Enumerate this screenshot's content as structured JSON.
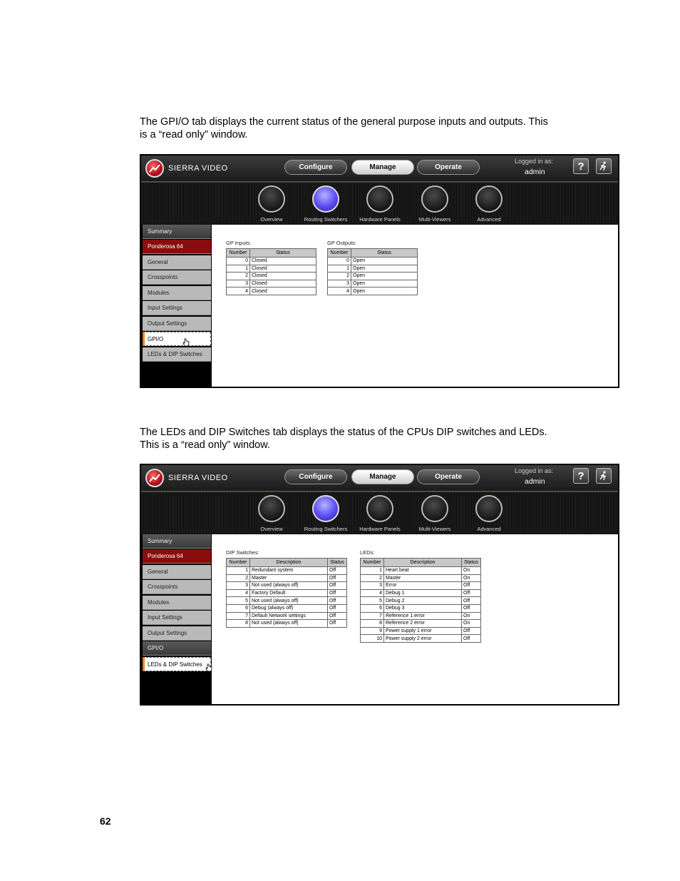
{
  "paragraphs": {
    "gpio_intro": [
      "The GPI/O tab displays the current status of the general purpose inputs and outputs. This",
      "is a “read only” window."
    ],
    "leds_intro": [
      "The LEDs and DIP Switches tab displays the status of the CPUs DIP switches and LEDs.",
      "This is a “read only” window."
    ]
  },
  "app": {
    "brand": "SIERRA VIDEO",
    "nav": [
      "Configure",
      "Manage",
      "Operate"
    ],
    "active_nav": "Manage",
    "logged_in_label": "Logged in as:",
    "user": "admin",
    "help_icon": "?",
    "exit_icon": "logout-runner-icon",
    "icon_tabs": [
      "Overview",
      "Routing Switchers",
      "Hardware Panels",
      "Multi-Viewers",
      "Advanced"
    ],
    "active_icon_tab": "Routing Switchers",
    "sidebar": [
      "Summary",
      "Ponderosa 64",
      "General",
      "Crosspoints",
      "Modules",
      "Input Settings",
      "Output Settings",
      "GPI/O",
      "LEDs & DIP Switches"
    ],
    "colors": {
      "accent_red": "#8a0d0d",
      "active_blue": "#5a4cf2",
      "selected_marker": "#f08020"
    }
  },
  "gpio": {
    "selected_sidebar": "GPI/O",
    "inputs_title": "GP Inputs:",
    "outputs_title": "GP Outputs:",
    "headers": [
      "Number",
      "Status"
    ],
    "inputs": [
      [
        "0",
        "Closed"
      ],
      [
        "1",
        "Closed"
      ],
      [
        "2",
        "Closed"
      ],
      [
        "3",
        "Closed"
      ],
      [
        "4",
        "Closed"
      ]
    ],
    "outputs": [
      [
        "0",
        "Open"
      ],
      [
        "1",
        "Open"
      ],
      [
        "2",
        "Open"
      ],
      [
        "3",
        "Open"
      ],
      [
        "4",
        "Open"
      ]
    ]
  },
  "leds": {
    "selected_sidebar": "LEDs & DIP Switches",
    "dip_title": "DIP Switches:",
    "leds_title": "LEDs:",
    "headers": [
      "Number",
      "Description",
      "Status"
    ],
    "dip": [
      [
        "1",
        "Redundant system",
        "Off"
      ],
      [
        "2",
        "Master",
        "Off"
      ],
      [
        "3",
        "Not used (always off)",
        "Off"
      ],
      [
        "4",
        "Factory Default",
        "Off"
      ],
      [
        "5",
        "Not used (always off)",
        "Off"
      ],
      [
        "6",
        "Debug (always off)",
        "Off"
      ],
      [
        "7",
        "Default Network settings",
        "Off"
      ],
      [
        "8",
        "Not used (always off)",
        "Off"
      ]
    ],
    "led_rows": [
      [
        "1",
        "Heart beat",
        "On"
      ],
      [
        "2",
        "Master",
        "On"
      ],
      [
        "3",
        "Error",
        "Off"
      ],
      [
        "4",
        "Debug 1",
        "Off"
      ],
      [
        "5",
        "Debug 2",
        "Off"
      ],
      [
        "6",
        "Debug 3",
        "Off"
      ],
      [
        "7",
        "Reference 1 error",
        "On"
      ],
      [
        "8",
        "Reference 2 error",
        "On"
      ],
      [
        "9",
        "Power supply 1 error",
        "Off"
      ],
      [
        "10",
        "Power supply 2 error",
        "Off"
      ]
    ]
  },
  "page_number": "62"
}
